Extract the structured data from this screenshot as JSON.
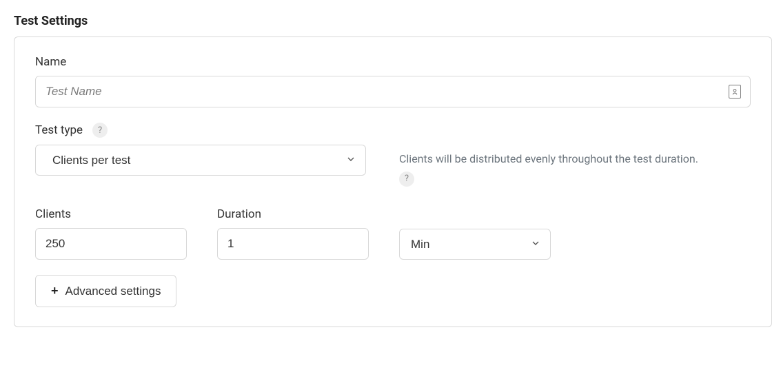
{
  "section_title": "Test Settings",
  "name": {
    "label": "Name",
    "placeholder": "Test Name",
    "value": ""
  },
  "test_type": {
    "label": "Test type",
    "selected": "Clients per test",
    "description": "Clients will be distributed evenly throughout the test duration."
  },
  "clients": {
    "label": "Clients",
    "value": "250"
  },
  "duration": {
    "label": "Duration",
    "value": "1",
    "unit": "Min"
  },
  "advanced_button": "Advanced settings",
  "icons": {
    "help": "?",
    "plus": "+"
  }
}
